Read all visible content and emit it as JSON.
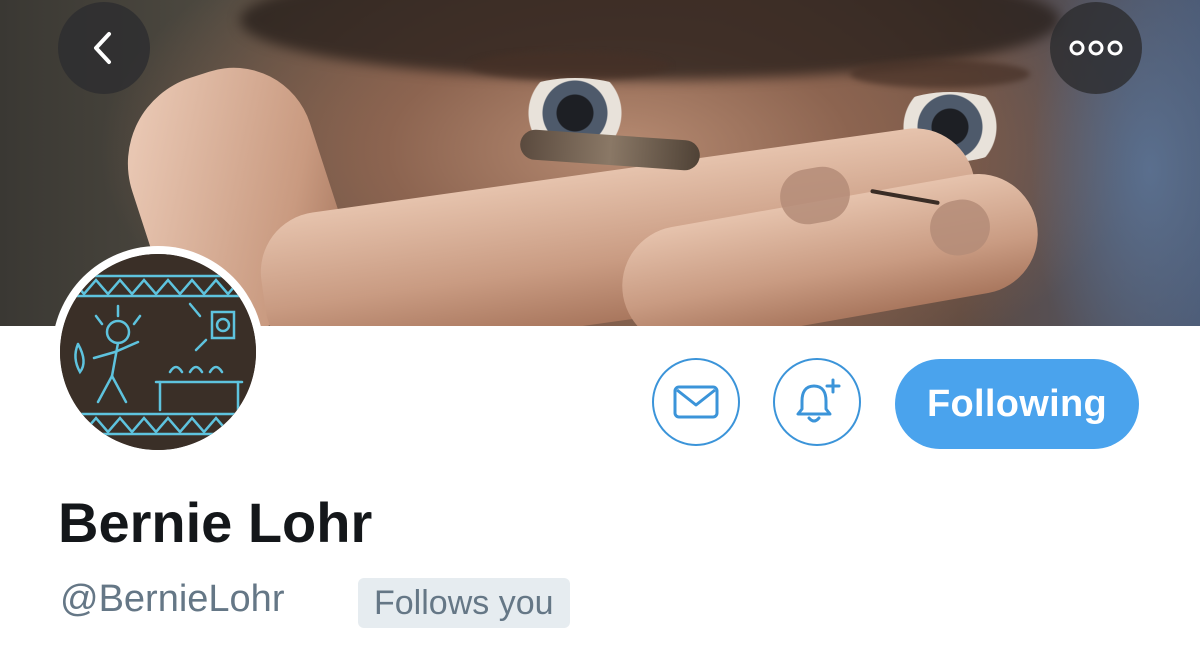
{
  "header": {
    "back_icon": "chevron-left-icon",
    "more_icon": "more-horizontal-icon"
  },
  "profile": {
    "display_name": "Bernie Lohr",
    "handle": "@BernieLohr",
    "follows_you_badge": "Follows you"
  },
  "actions": {
    "message_icon": "envelope-icon",
    "notifications_icon": "bell-plus-icon",
    "following_label": "Following"
  },
  "colors": {
    "accent": "#4aa3ed",
    "outline": "#3b94d9",
    "name": "#14171a",
    "secondary_text": "#657786",
    "badge_bg": "#e6ecf0"
  }
}
